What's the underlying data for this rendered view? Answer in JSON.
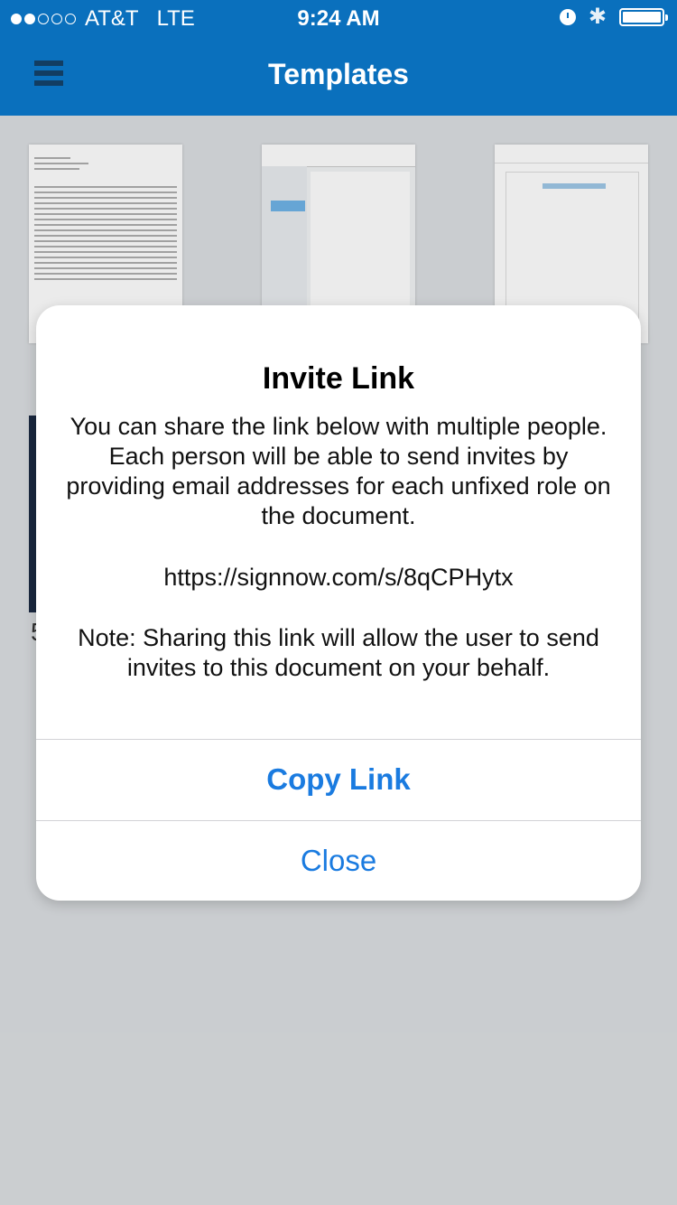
{
  "status_bar": {
    "carrier": "AT&T",
    "network": "LTE",
    "time": "9:24 AM"
  },
  "nav": {
    "title": "Templates",
    "menu_icon": "hamburger-menu-icon"
  },
  "background_partial_text": "5",
  "dialog": {
    "title": "Invite Link",
    "message": "You can share the link below with multiple people. Each person will be able to send invites by providing email addresses for each unfixed role on the document.",
    "link": "https://signnow.com/s/8qCPHytx",
    "note": "Note: Sharing this link will allow the user to send invites to this document on your behalf.",
    "copy_label": "Copy Link",
    "close_label": "Close"
  },
  "colors": {
    "header_blue": "#0a70bd",
    "button_blue": "#1a7be0"
  }
}
